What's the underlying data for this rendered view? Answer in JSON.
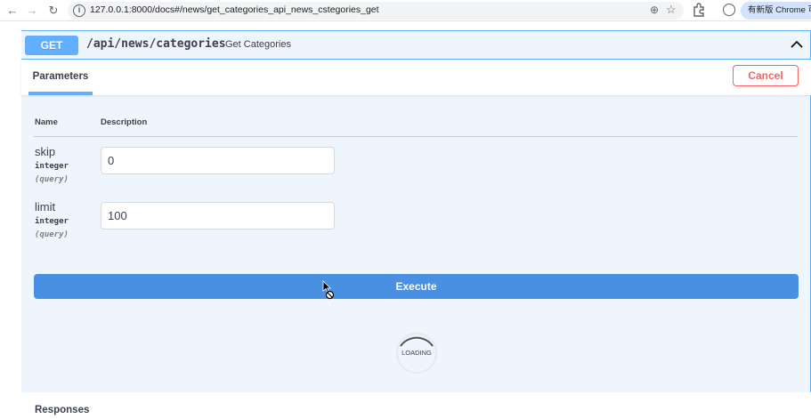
{
  "browser": {
    "url": "127.0.0.1:8000/docs#/news/get_categories_api_news_cstegories_get",
    "chip_label": "有新版 Chrome 可用"
  },
  "operation": {
    "method": "GET",
    "path": "/api/news/categories",
    "summary": "Get Categories",
    "accent_color": "#61affe"
  },
  "params_section": {
    "tab_label": "Parameters",
    "cancel_label": "Cancel",
    "col_name": "Name",
    "col_description": "Description",
    "params": [
      {
        "name": "skip",
        "type": "integer",
        "in": "(query)",
        "value": "0"
      },
      {
        "name": "limit",
        "type": "integer",
        "in": "(query)",
        "value": "100"
      }
    ]
  },
  "execute_label": "Execute",
  "loading_label": "LOADING",
  "responses_label": "Responses"
}
